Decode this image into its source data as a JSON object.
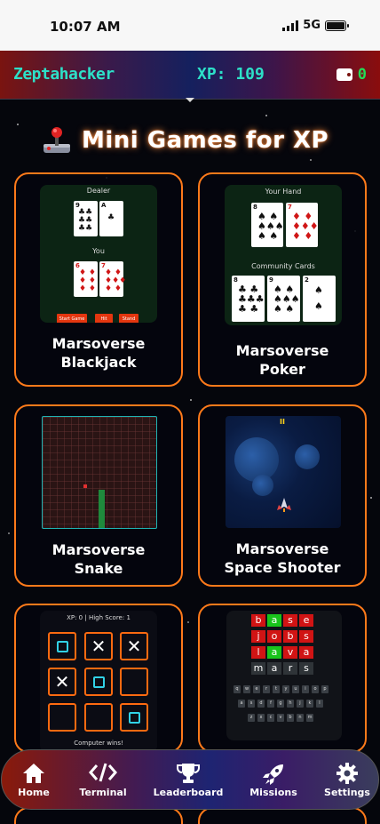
{
  "status_bar": {
    "time": "10:07 AM",
    "network": "5G"
  },
  "header": {
    "username": "Zeptahacker",
    "xp": "XP: 109",
    "wallet_count": "0"
  },
  "page": {
    "title": "Mini Games for XP"
  },
  "games": [
    {
      "id": "blackjack",
      "title_line1": "Marsoverse",
      "title_line2": "Blackjack",
      "preview": {
        "dealer_label": "Dealer",
        "you_label": "You",
        "buttons": [
          "Start Game",
          "Hit",
          "Stand"
        ]
      }
    },
    {
      "id": "poker",
      "title_line1": "Marsoverse",
      "title_line2": "Poker",
      "preview": {
        "hand_label": "Your Hand",
        "community_label": "Community Cards"
      }
    },
    {
      "id": "snake",
      "title_line1": "Marsoverse",
      "title_line2": "Snake"
    },
    {
      "id": "space-shooter",
      "title_line1": "Marsoverse",
      "title_line2": "Space Shooter",
      "preview": {
        "pause_glyph": "II"
      }
    },
    {
      "id": "tictactoe",
      "preview": {
        "score_text": "XP: 0 | High Score: 1",
        "result_text": "Computer wins!",
        "board": [
          "O",
          "X",
          "X",
          "X",
          "O",
          "",
          "",
          "",
          "O"
        ]
      }
    },
    {
      "id": "wordle",
      "preview": {
        "rows": [
          [
            "b",
            "a",
            "s",
            "e"
          ],
          [
            "j",
            "o",
            "b",
            "s"
          ],
          [
            "l",
            "a",
            "v",
            "a"
          ],
          [
            "m",
            "a",
            "r",
            "s"
          ]
        ],
        "keyboard": [
          [
            "q",
            "w",
            "e",
            "r",
            "t",
            "y",
            "u",
            "i",
            "o",
            "p"
          ],
          [
            "a",
            "s",
            "d",
            "f",
            "g",
            "h",
            "j",
            "k",
            "l"
          ],
          [
            "z",
            "x",
            "c",
            "v",
            "b",
            "n",
            "m"
          ]
        ]
      }
    }
  ],
  "nav": [
    {
      "label": "Home",
      "icon": "home-icon"
    },
    {
      "label": "Terminal",
      "icon": "code-icon"
    },
    {
      "label": "Leaderboard",
      "icon": "trophy-icon"
    },
    {
      "label": "Missions",
      "icon": "rocket-icon"
    },
    {
      "label": "Settings",
      "icon": "gear-icon"
    }
  ],
  "colors": {
    "accent": "#ff7a1a",
    "xp": "#2de0c8",
    "wallet": "#22dd55",
    "tile_red": "#d11414",
    "tile_green": "#19c41b",
    "tile_gray": "#2f3438"
  }
}
